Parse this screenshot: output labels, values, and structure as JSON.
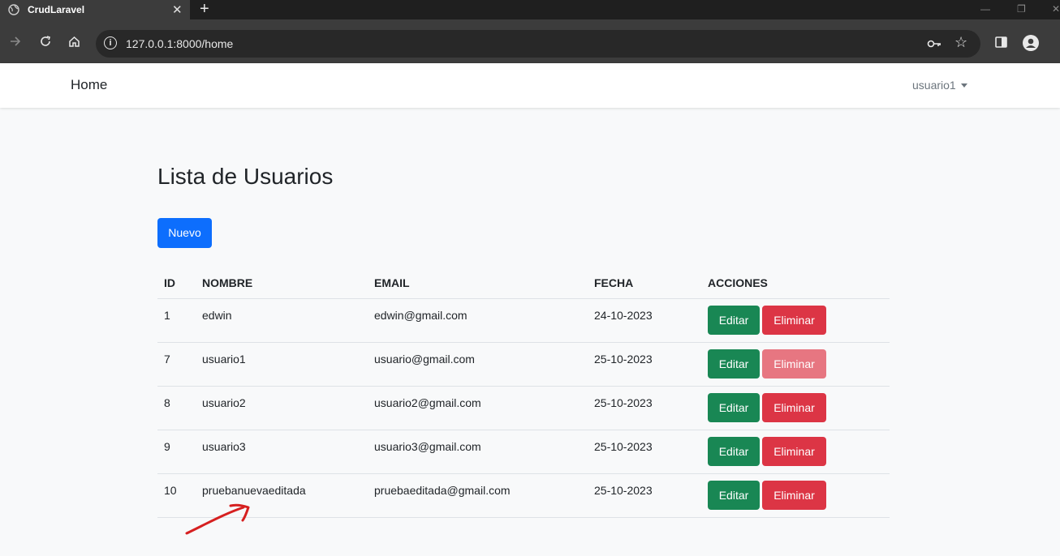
{
  "browser": {
    "tab_title": "CrudLaravel",
    "url": "127.0.0.1:8000/home"
  },
  "navbar": {
    "brand": "Home",
    "user": "usuario1"
  },
  "page": {
    "title": "Lista de Usuarios",
    "new_button": "Nuevo"
  },
  "table": {
    "headers": [
      "ID",
      "NOMBRE",
      "EMAIL",
      "FECHA",
      "ACCIONES"
    ],
    "edit_label": "Editar",
    "delete_label": "Eliminar",
    "rows": [
      {
        "id": "1",
        "name": "edwin",
        "email": "edwin@gmail.com",
        "date": "24-10-2023",
        "delete_disabled": false
      },
      {
        "id": "7",
        "name": "usuario1",
        "email": "usuario@gmail.com",
        "date": "25-10-2023",
        "delete_disabled": true
      },
      {
        "id": "8",
        "name": "usuario2",
        "email": "usuario2@gmail.com",
        "date": "25-10-2023",
        "delete_disabled": false
      },
      {
        "id": "9",
        "name": "usuario3",
        "email": "usuario3@gmail.com",
        "date": "25-10-2023",
        "delete_disabled": false
      },
      {
        "id": "10",
        "name": "pruebanuevaeditada",
        "email": "pruebaeditada@gmail.com",
        "date": "25-10-2023",
        "delete_disabled": false
      }
    ]
  },
  "colors": {
    "primary": "#0d6efd",
    "success": "#198754",
    "danger": "#dc3545",
    "danger_disabled": "#e77681",
    "annotation": "#d62020"
  }
}
